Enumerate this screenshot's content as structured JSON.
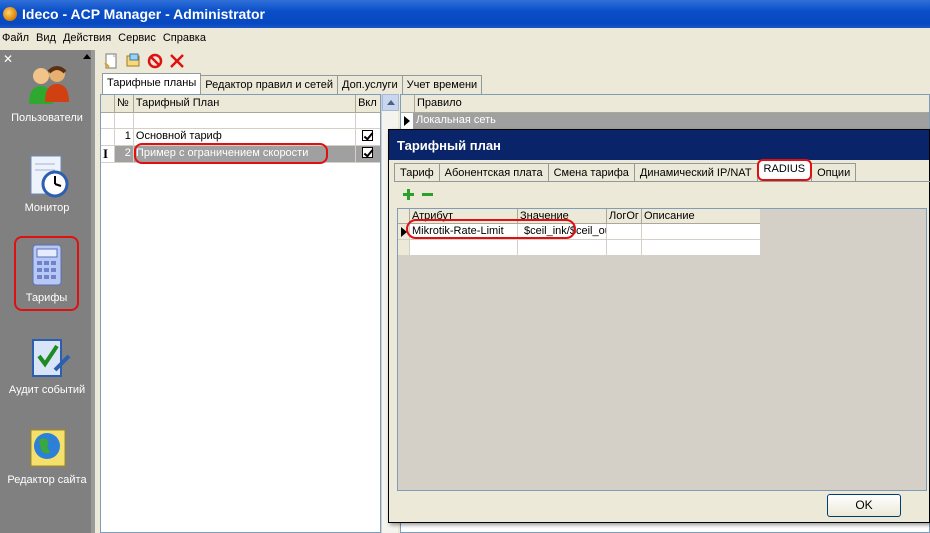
{
  "window": {
    "title": "Ideco - ACP Manager - Administrator"
  },
  "menu": [
    "Файл",
    "Вид",
    "Действия",
    "Сервис",
    "Справка"
  ],
  "sidebar": {
    "items": [
      {
        "label": "Пользователи",
        "icon": "users-icon"
      },
      {
        "label": "Монитор",
        "icon": "monitor-clock-icon"
      },
      {
        "label": "Тарифы",
        "icon": "calculator-icon",
        "active": true
      },
      {
        "label": "Аудит событий",
        "icon": "audit-check-icon"
      },
      {
        "label": "Редактор сайта",
        "icon": "globe-icon"
      }
    ]
  },
  "main_tabs": [
    "Тарифные планы",
    "Редактор правил и сетей",
    "Доп.услуги",
    "Учет времени"
  ],
  "plans_table": {
    "columns": [
      "№",
      "Тарифный План",
      "Вкл"
    ],
    "rows": [
      {
        "n": "1",
        "name": "Основной тариф",
        "enabled": true
      },
      {
        "n": "2",
        "name": "Пример с ограничением скорости",
        "enabled": true,
        "marker": "I"
      }
    ]
  },
  "rules_table": {
    "columns": [
      "Правило"
    ],
    "rows": [
      "Локальная сеть"
    ]
  },
  "dialog": {
    "title": "Тарифный план",
    "tabs": [
      "Тариф",
      "Абонентская плата",
      "Смена тарифа",
      "Динамический IP/NAT",
      "RADIUS",
      "Опции"
    ],
    "active_tab": "RADIUS",
    "attr_table": {
      "columns": [
        "Атрибут",
        "Значение",
        "ЛогОг",
        "Описание"
      ],
      "rows": [
        {
          "attr": "Mikrotik-Rate-Limit",
          "value": "$ceil_ink/$ceil_outk",
          "log": "",
          "desc": ""
        }
      ]
    },
    "ok_label": "OK"
  },
  "colors": {
    "annotation_red": "#e01010",
    "title_blue": "#0a4fc8",
    "sidebar_gray": "#808080"
  }
}
